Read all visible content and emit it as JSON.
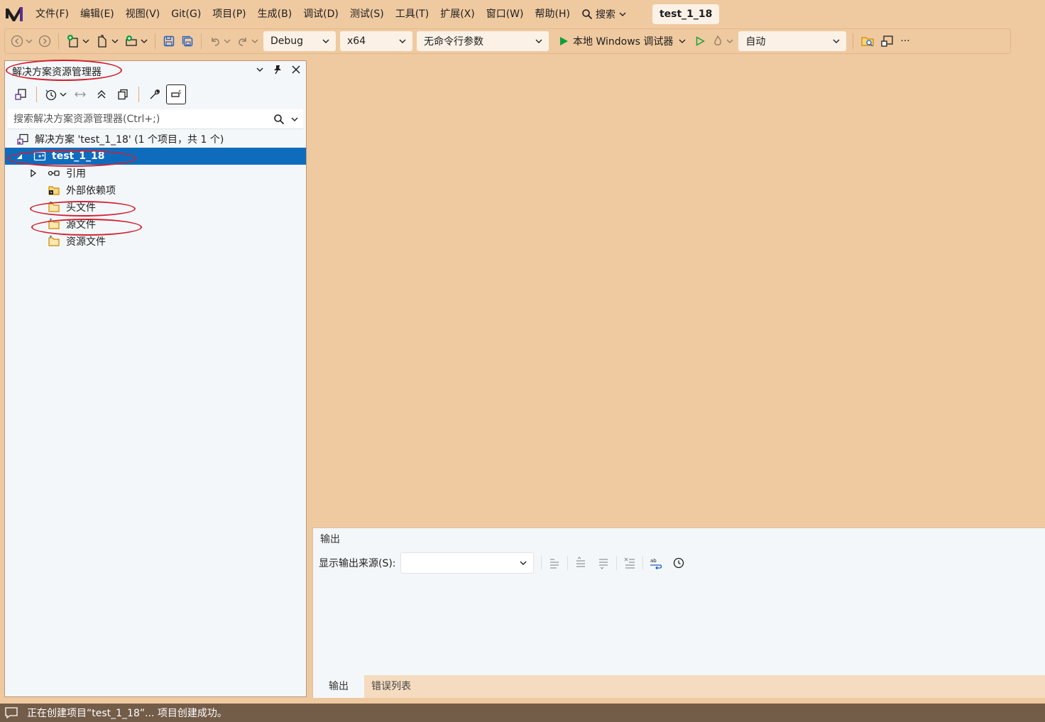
{
  "colors": {
    "background": "#efc9a0",
    "panel": "#f4f7f9",
    "selection": "#0f6cbd",
    "statusbar": "#735d48",
    "annotation": "#d22030",
    "run_green": "#0e9f3a"
  },
  "menubar": {
    "items": [
      "文件(F)",
      "编辑(E)",
      "视图(V)",
      "Git(G)",
      "项目(P)",
      "生成(B)",
      "调试(D)",
      "测试(S)",
      "工具(T)",
      "扩展(X)",
      "窗口(W)",
      "帮助(H)"
    ],
    "search_label": "搜索",
    "solution_tab": "test_1_18"
  },
  "toolbar": {
    "config": "Debug",
    "platform": "x64",
    "args": "无命令行参数",
    "run_label": "本地 Windows 调试器",
    "auto": "自动",
    "more": "···"
  },
  "solution_explorer": {
    "title": "解决方案资源管理器",
    "search_placeholder": "搜索解决方案资源管理器(Ctrl+;)",
    "tree": {
      "solution": "解决方案 'test_1_18' (1 个项目，共 1 个)",
      "project": "test_1_18",
      "references": "引用",
      "external_deps": "外部依赖项",
      "header_files": "头文件",
      "source_files": "源文件",
      "resource_files": "资源文件"
    }
  },
  "output": {
    "title": "输出",
    "source_label": "显示输出来源(S):",
    "source_value": "",
    "tabs": [
      "输出",
      "错误列表"
    ]
  },
  "status": {
    "message": "正在创建项目“test_1_18”... 项目创建成功。"
  }
}
